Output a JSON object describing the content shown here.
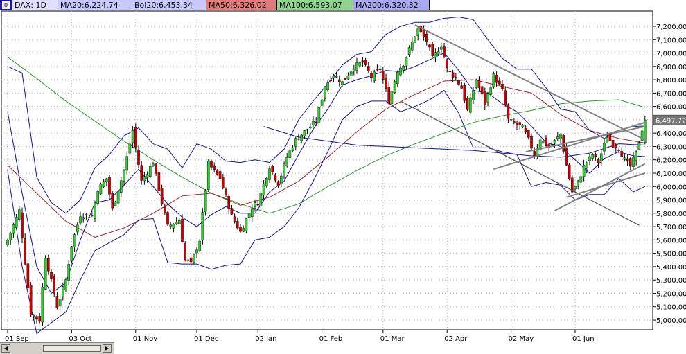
{
  "legend": {
    "symbol": "DAX: 1D",
    "ma20": "MA20:6,224.74",
    "bol20": "Bol20:6,453.34",
    "ma50": "MA50:6,326.02",
    "ma100": "MA100:6,593.07",
    "ma200": "MA200:6,320.32"
  },
  "colors": {
    "up_candle": "#33cc33",
    "down_candle": "#cc0000",
    "bollinger": "#1010a0",
    "ma20": "#1010a0",
    "ma50": "#a02020",
    "ma200": "#2a9a2a",
    "trendline": "#808080",
    "grid": "#b4b4b4"
  },
  "chart_data": {
    "type": "candlestick",
    "title": "DAX: 1D",
    "x_tick_labels": [
      "01 Sep",
      "03 Oct",
      "01 Nov",
      "01 Dec",
      "02 Jan",
      "01 Feb",
      "01 Mar",
      "02 Apr",
      "02 May",
      "01 Jun"
    ],
    "x_tick_bars": [
      0,
      22,
      44,
      65,
      86,
      108,
      129,
      151,
      173,
      195
    ],
    "y_tick_labels": [
      "5,000.00",
      "5,100.00",
      "5,200.00",
      "5,300.00",
      "5,400.00",
      "5,500.00",
      "5,600.00",
      "5,700.00",
      "5,800.00",
      "5,900.00",
      "6,000.00",
      "6,100.00",
      "6,200.00",
      "6,300.00",
      "6,400.00",
      "6,500.00",
      "6,600.00",
      "6,700.00",
      "6,800.00",
      "6,900.00",
      "7,000.00",
      "7,100.00",
      "7,200.00"
    ],
    "ylim": [
      4950,
      7275
    ],
    "last_price_label": "6,497.72",
    "last_price": 6497.72,
    "grid": true,
    "close_anchors": [
      [
        0,
        5600
      ],
      [
        4,
        5820
      ],
      [
        8,
        5050
      ],
      [
        11,
        5000
      ],
      [
        13,
        5480
      ],
      [
        17,
        5100
      ],
      [
        20,
        5300
      ],
      [
        22,
        5560
      ],
      [
        25,
        5790
      ],
      [
        29,
        5780
      ],
      [
        31,
        5980
      ],
      [
        34,
        6060
      ],
      [
        36,
        5830
      ],
      [
        40,
        6120
      ],
      [
        43,
        6420
      ],
      [
        46,
        6040
      ],
      [
        50,
        6180
      ],
      [
        53,
        5880
      ],
      [
        55,
        5700
      ],
      [
        59,
        5750
      ],
      [
        61,
        5450
      ],
      [
        63,
        5420
      ],
      [
        66,
        5600
      ],
      [
        69,
        6170
      ],
      [
        73,
        6060
      ],
      [
        77,
        5780
      ],
      [
        80,
        5660
      ],
      [
        84,
        5850
      ],
      [
        86,
        5880
      ],
      [
        90,
        6150
      ],
      [
        93,
        6020
      ],
      [
        96,
        6220
      ],
      [
        99,
        6350
      ],
      [
        103,
        6430
      ],
      [
        106,
        6490
      ],
      [
        109,
        6750
      ],
      [
        112,
        6840
      ],
      [
        115,
        6780
      ],
      [
        119,
        6900
      ],
      [
        122,
        6930
      ],
      [
        125,
        6820
      ],
      [
        128,
        6880
      ],
      [
        131,
        6640
      ],
      [
        134,
        6870
      ],
      [
        136,
        6920
      ],
      [
        139,
        7080
      ],
      [
        141,
        7180
      ],
      [
        144,
        7090
      ],
      [
        146,
        6960
      ],
      [
        149,
        7060
      ],
      [
        151,
        6880
      ],
      [
        154,
        6810
      ],
      [
        156,
        6740
      ],
      [
        158,
        6570
      ],
      [
        161,
        6800
      ],
      [
        164,
        6620
      ],
      [
        167,
        6830
      ],
      [
        170,
        6720
      ],
      [
        172,
        6500
      ],
      [
        175,
        6460
      ],
      [
        177,
        6440
      ],
      [
        179,
        6350
      ],
      [
        181,
        6240
      ],
      [
        183,
        6360
      ],
      [
        186,
        6290
      ],
      [
        190,
        6390
      ],
      [
        192,
        6160
      ],
      [
        194,
        5960
      ],
      [
        196,
        6030
      ],
      [
        198,
        6150
      ],
      [
        201,
        6240
      ],
      [
        203,
        6180
      ],
      [
        206,
        6380
      ],
      [
        208,
        6310
      ],
      [
        210,
        6290
      ],
      [
        212,
        6200
      ],
      [
        214,
        6150
      ],
      [
        216,
        6250
      ],
      [
        218,
        6430
      ],
      [
        219,
        6490
      ]
    ],
    "indicator_anchors": {
      "ma20": [
        [
          0,
          6560
        ],
        [
          5,
          5950
        ],
        [
          10,
          5400
        ],
        [
          15,
          5200
        ],
        [
          20,
          5280
        ],
        [
          25,
          5600
        ],
        [
          30,
          5880
        ],
        [
          35,
          5900
        ],
        [
          40,
          6010
        ],
        [
          45,
          6130
        ],
        [
          50,
          6000
        ],
        [
          55,
          5870
        ],
        [
          60,
          5770
        ],
        [
          65,
          5700
        ],
        [
          70,
          5790
        ],
        [
          75,
          5850
        ],
        [
          80,
          5800
        ],
        [
          85,
          5800
        ],
        [
          90,
          5960
        ],
        [
          95,
          6040
        ],
        [
          100,
          6240
        ],
        [
          105,
          6430
        ],
        [
          110,
          6580
        ],
        [
          115,
          6760
        ],
        [
          120,
          6800
        ],
        [
          125,
          6830
        ],
        [
          130,
          6870
        ],
        [
          135,
          6860
        ],
        [
          140,
          6900
        ],
        [
          145,
          6950
        ],
        [
          150,
          7000
        ],
        [
          155,
          6870
        ],
        [
          160,
          6720
        ],
        [
          165,
          6700
        ],
        [
          170,
          6620
        ],
        [
          175,
          6560
        ],
        [
          180,
          6450
        ],
        [
          185,
          6330
        ],
        [
          190,
          6300
        ],
        [
          195,
          6200
        ],
        [
          200,
          6100
        ],
        [
          205,
          6210
        ],
        [
          210,
          6260
        ],
        [
          215,
          6230
        ],
        [
          219,
          6225
        ]
      ],
      "bol_upper": [
        [
          0,
          6900
        ],
        [
          5,
          6850
        ],
        [
          10,
          6070
        ],
        [
          15,
          5880
        ],
        [
          20,
          5800
        ],
        [
          25,
          5900
        ],
        [
          30,
          6140
        ],
        [
          35,
          6240
        ],
        [
          40,
          6380
        ],
        [
          45,
          6440
        ],
        [
          50,
          6320
        ],
        [
          55,
          6280
        ],
        [
          60,
          6140
        ],
        [
          65,
          6320
        ],
        [
          70,
          6280
        ],
        [
          75,
          6190
        ],
        [
          80,
          6180
        ],
        [
          85,
          6200
        ],
        [
          90,
          6180
        ],
        [
          95,
          6280
        ],
        [
          100,
          6500
        ],
        [
          105,
          6640
        ],
        [
          110,
          6770
        ],
        [
          115,
          6910
        ],
        [
          120,
          6990
        ],
        [
          125,
          7010
        ],
        [
          130,
          7140
        ],
        [
          135,
          7200
        ],
        [
          140,
          7230
        ],
        [
          145,
          7230
        ],
        [
          150,
          7260
        ],
        [
          155,
          7270
        ],
        [
          160,
          7250
        ],
        [
          165,
          7100
        ],
        [
          170,
          6960
        ],
        [
          175,
          6880
        ],
        [
          180,
          6880
        ],
        [
          185,
          6740
        ],
        [
          190,
          6580
        ],
        [
          195,
          6560
        ],
        [
          200,
          6420
        ],
        [
          205,
          6360
        ],
        [
          210,
          6420
        ],
        [
          215,
          6450
        ],
        [
          219,
          6453
        ]
      ],
      "bol_lower": [
        [
          0,
          6120
        ],
        [
          5,
          5400
        ],
        [
          10,
          4900
        ],
        [
          15,
          4980
        ],
        [
          20,
          5060
        ],
        [
          25,
          5300
        ],
        [
          30,
          5520
        ],
        [
          35,
          5580
        ],
        [
          40,
          5640
        ],
        [
          45,
          5750
        ],
        [
          50,
          5760
        ],
        [
          55,
          5430
        ],
        [
          60,
          5420
        ],
        [
          65,
          5420
        ],
        [
          70,
          5380
        ],
        [
          75,
          5410
        ],
        [
          80,
          5420
        ],
        [
          85,
          5600
        ],
        [
          90,
          5620
        ],
        [
          95,
          5700
        ],
        [
          100,
          5840
        ],
        [
          105,
          6040
        ],
        [
          110,
          6260
        ],
        [
          115,
          6500
        ],
        [
          120,
          6600
        ],
        [
          125,
          6640
        ],
        [
          130,
          6640
        ],
        [
          135,
          6560
        ],
        [
          140,
          6600
        ],
        [
          145,
          6650
        ],
        [
          150,
          6720
        ],
        [
          155,
          6550
        ],
        [
          160,
          6290
        ],
        [
          165,
          6290
        ],
        [
          170,
          6260
        ],
        [
          175,
          6240
        ],
        [
          180,
          6000
        ],
        [
          185,
          6030
        ],
        [
          190,
          6010
        ],
        [
          195,
          5900
        ],
        [
          200,
          5940
        ],
        [
          205,
          5940
        ],
        [
          210,
          6060
        ],
        [
          215,
          5960
        ],
        [
          219,
          6000
        ]
      ],
      "ma50": [
        [
          0,
          6160
        ],
        [
          10,
          5950
        ],
        [
          20,
          5740
        ],
        [
          30,
          5620
        ],
        [
          40,
          5690
        ],
        [
          50,
          5800
        ],
        [
          60,
          5930
        ],
        [
          70,
          5950
        ],
        [
          80,
          5860
        ],
        [
          90,
          5920
        ],
        [
          100,
          6040
        ],
        [
          110,
          6220
        ],
        [
          120,
          6410
        ],
        [
          130,
          6580
        ],
        [
          140,
          6690
        ],
        [
          150,
          6790
        ],
        [
          160,
          6800
        ],
        [
          170,
          6750
        ],
        [
          180,
          6700
        ],
        [
          190,
          6540
        ],
        [
          200,
          6420
        ],
        [
          210,
          6360
        ],
        [
          219,
          6326
        ]
      ],
      "ma200": [
        [
          0,
          6970
        ],
        [
          10,
          6810
        ],
        [
          20,
          6640
        ],
        [
          30,
          6490
        ],
        [
          40,
          6340
        ],
        [
          50,
          6200
        ],
        [
          60,
          6070
        ],
        [
          70,
          5950
        ],
        [
          80,
          5870
        ],
        [
          90,
          5800
        ],
        [
          100,
          5870
        ],
        [
          110,
          6000
        ],
        [
          120,
          6120
        ],
        [
          130,
          6230
        ],
        [
          140,
          6320
        ],
        [
          150,
          6400
        ],
        [
          160,
          6480
        ],
        [
          170,
          6530
        ],
        [
          180,
          6570
        ],
        [
          190,
          6620
        ],
        [
          200,
          6640
        ],
        [
          210,
          6650
        ],
        [
          219,
          6593
        ]
      ],
      "ma100": [
        [
          88,
          6450
        ],
        [
          100,
          6370
        ],
        [
          110,
          6340
        ],
        [
          120,
          6310
        ],
        [
          130,
          6300
        ],
        [
          140,
          6290
        ],
        [
          150,
          6280
        ],
        [
          160,
          6270
        ],
        [
          170,
          6250
        ],
        [
          180,
          6230
        ],
        [
          190,
          6220
        ],
        [
          200,
          6250
        ],
        [
          210,
          6320
        ],
        [
          219,
          6310
        ]
      ]
    },
    "trendlines": [
      [
        [
          140,
          7210
        ],
        [
          219,
          6350
        ]
      ],
      [
        [
          135,
          6640
        ],
        [
          217,
          5710
        ]
      ],
      [
        [
          167,
          6130
        ],
        [
          219,
          6480
        ]
      ],
      [
        [
          178,
          6260
        ],
        [
          219,
          6450
        ]
      ],
      [
        [
          188,
          5820
        ],
        [
          219,
          6170
        ]
      ],
      [
        [
          192,
          5920
        ],
        [
          219,
          6100
        ]
      ]
    ]
  }
}
